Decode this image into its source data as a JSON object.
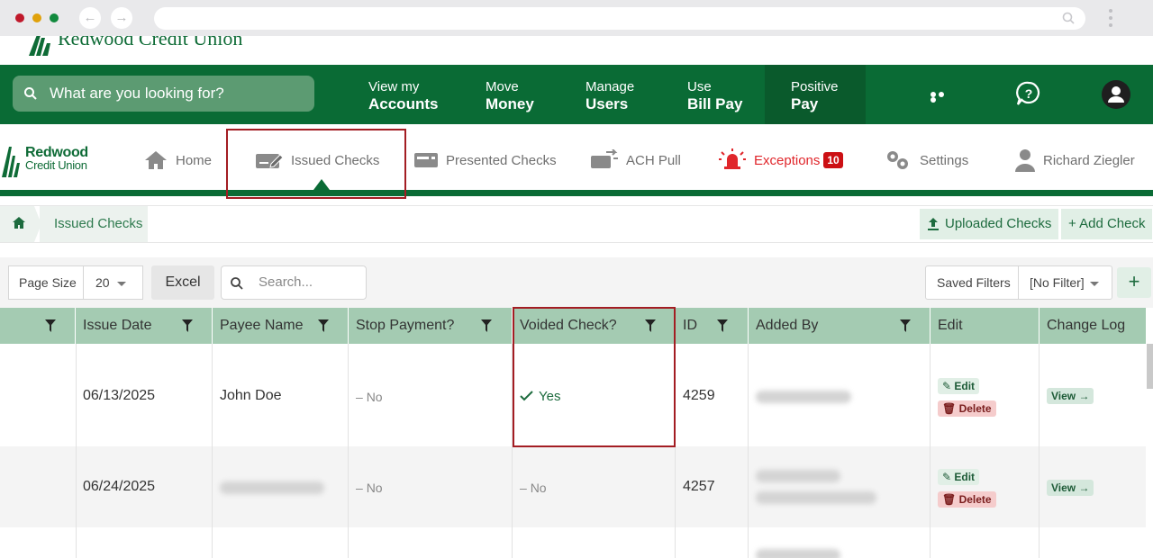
{
  "browser": {
    "dots": [
      "#c0192b",
      "#e0a10b",
      "#128a3e"
    ]
  },
  "brand": {
    "name": "Redwood Credit Union",
    "sub_line1": "Redwood",
    "sub_line2": "Credit Union"
  },
  "search": {
    "placeholder": "What are you looking for?"
  },
  "topnav": {
    "items": [
      {
        "line1": "View my",
        "line2": "Accounts"
      },
      {
        "line1": "Move",
        "line2": "Money"
      },
      {
        "line1": "Manage",
        "line2": "Users"
      },
      {
        "line1": "Use",
        "line2": "Bill Pay"
      },
      {
        "line1": "Positive",
        "line2": "Pay"
      }
    ]
  },
  "subnav": {
    "home": "Home",
    "issued": "Issued Checks",
    "presented": "Presented Checks",
    "ach": "ACH Pull",
    "exceptions": "Exceptions",
    "exceptions_count": "10",
    "settings": "Settings",
    "user": "Richard Ziegler"
  },
  "breadcrumb": {
    "current": "Issued Checks"
  },
  "actions": {
    "uploaded": "Uploaded Checks",
    "add": "+ Add Check"
  },
  "toolbar": {
    "page_size_label": "Page Size",
    "page_size_value": "20",
    "excel": "Excel",
    "search_placeholder": "Search...",
    "saved_filters": "Saved Filters",
    "filter_value": "[No Filter]",
    "plus": "+"
  },
  "table": {
    "headers": {
      "issue_date": "Issue Date",
      "payee": "Payee Name",
      "stop": "Stop Payment?",
      "voided": "Voided Check?",
      "id": "ID",
      "added_by": "Added By",
      "edit": "Edit",
      "log": "Change Log"
    },
    "rows": [
      {
        "issue_date": "06/13/2025",
        "payee": "John Doe",
        "stop": "No",
        "voided": "Yes",
        "id": "4259"
      },
      {
        "issue_date": "06/24/2025",
        "stop": "No",
        "voided": "No",
        "id": "4257"
      }
    ],
    "edit_label": "Edit",
    "delete_label": "Delete",
    "view_label": "View"
  },
  "colors": {
    "brand_green": "#0a6b35",
    "header_green": "#a4cbb2",
    "alert_red": "#cc1014"
  }
}
